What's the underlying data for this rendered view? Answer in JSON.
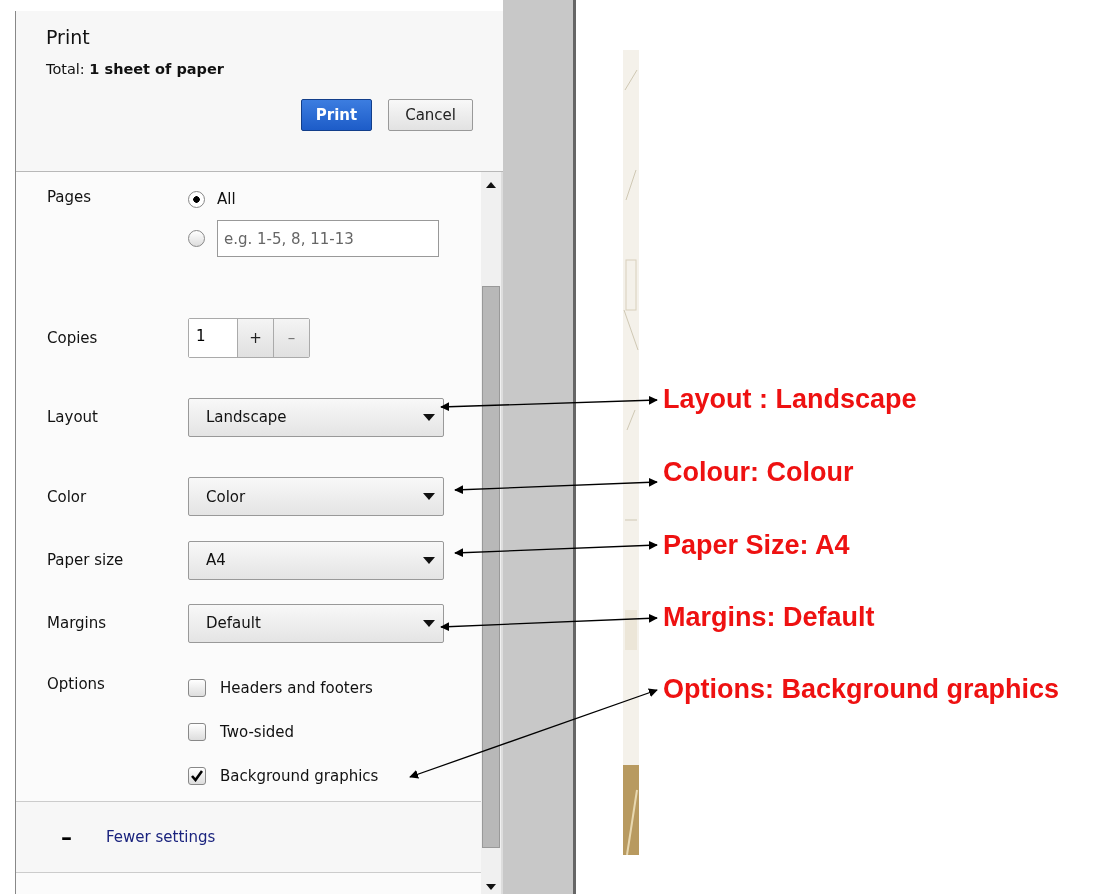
{
  "dialog": {
    "title": "Print",
    "total": "Total: **1 sheet of paper**",
    "buttons": [
      {
        "label": "Print",
        "kind": "primary"
      },
      {
        "label": "Cancel",
        "kind": "secondary"
      }
    ]
  },
  "pages": {
    "label": "Pages",
    "options": [
      {
        "kind": "label",
        "label": "All",
        "selected": true
      },
      {
        "kind": "range",
        "placeholder": "e.g. 1-5, 8, 11-13",
        "selected": false
      }
    ]
  },
  "copies": {
    "label": "Copies",
    "value": "1",
    "plus": "+",
    "minus": "–"
  },
  "selects": [
    {
      "label": "Layout",
      "value": "Landscape"
    },
    {
      "label": "Color",
      "value": "Color"
    },
    {
      "label": "Paper size",
      "value": "A4"
    },
    {
      "label": "Margins",
      "value": "Default"
    }
  ],
  "options": {
    "label": "Options",
    "items": [
      {
        "label": "Headers and footers",
        "checked": false
      },
      {
        "label": "Two-sided",
        "checked": false
      },
      {
        "label": "Background graphics",
        "checked": true
      }
    ]
  },
  "fewer_settings": {
    "icon": "–",
    "label": "Fewer settings"
  },
  "annotations": [
    {
      "text": "Layout : Landscape"
    },
    {
      "text": "Colour: Colour"
    },
    {
      "text": "Paper Size: A4"
    },
    {
      "text": "Margins: Default"
    },
    {
      "text": "Options: Background graphics"
    }
  ]
}
